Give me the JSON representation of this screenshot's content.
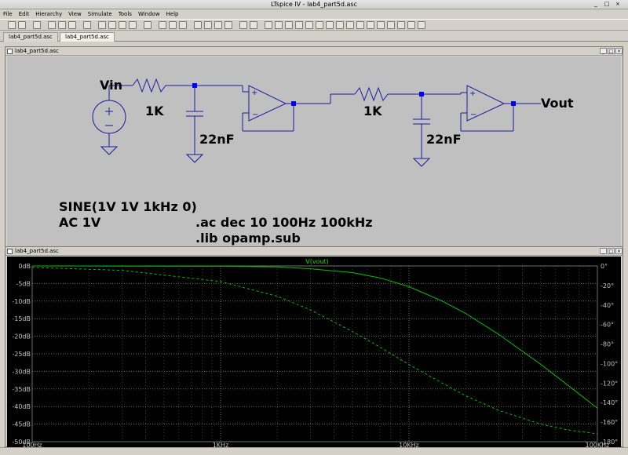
{
  "window": {
    "title": "LTspice IV - lab4_part5d.asc"
  },
  "menu": [
    "File",
    "Edit",
    "Hierarchy",
    "View",
    "Simulate",
    "Tools",
    "Window",
    "Help"
  ],
  "tabs": [
    {
      "label": "lab4_part5d.asc",
      "active": false
    },
    {
      "label": "lab4_part5d.asc",
      "active": true
    }
  ],
  "toolbar": {
    "icons": [
      "new-schematic-icon",
      "open-icon",
      "save-icon",
      "control-panel-icon",
      "run-icon",
      "halt-icon",
      "pan-icon",
      "zoom-in-icon",
      "zoom-out-icon",
      "zoom-full-icon",
      "zoom-cancel-icon",
      "waveform-icon",
      "tile-horizontal-icon",
      "tile-vertical-icon",
      "cascade-icon",
      "cut-icon",
      "copy-icon",
      "paste-icon",
      "find-icon",
      "print-icon",
      "print-setup-icon",
      "draw-wire-icon",
      "ground-icon",
      "label-net-icon",
      "resistor-icon",
      "capacitor-icon",
      "inductor-icon",
      "diode-icon",
      "component-icon",
      "rotate-icon",
      "mirror-icon",
      "undo-icon",
      "redo-icon",
      "move-icon",
      "drag-icon",
      "text-icon",
      "spice-directive-icon"
    ]
  },
  "schematic": {
    "title": "lab4_part5d.asc",
    "labels": {
      "vin": "Vin",
      "vout": "Vout",
      "r1": "1K",
      "r2": "1K",
      "c1": "22nF",
      "c2": "22nF",
      "source_sine": "SINE(1V 1V 1kHz 0)",
      "source_ac": "AC 1V",
      "ac_directive": ".ac dec 10 100Hz 100kHz",
      "lib_directive": ".lib opamp.sub"
    }
  },
  "plot": {
    "title": "lab4_part5d.asc",
    "trace_label": "V(vout)",
    "colors": {
      "background": "#000000",
      "grid": "#707070",
      "trace": "#00c000",
      "trace_label": "#00e000",
      "axis_text": "#c0c0c0"
    },
    "chart_data": {
      "type": "line",
      "xscale": "log",
      "xlim": [
        100,
        100000
      ],
      "x_ticks": [
        "100Hz",
        "1KHz",
        "10KHz",
        "100KHz"
      ],
      "y_left_ticks": [
        "0dB",
        "-5dB",
        "-10dB",
        "-15dB",
        "-20dB",
        "-25dB",
        "-30dB",
        "-35dB",
        "-40dB",
        "-45dB",
        "-50dB"
      ],
      "y_right_ticks": [
        "0°",
        "-20°",
        "-40°",
        "-60°",
        "-80°",
        "-100°",
        "-120°",
        "-140°",
        "-160°",
        "-180°"
      ],
      "ylim_left": [
        -50,
        0
      ],
      "ylim_right": [
        -180,
        0
      ],
      "series": [
        {
          "name": "V(vout)",
          "axis": "left",
          "style": "solid",
          "x": [
            100,
            300,
            1000,
            2000,
            3000,
            5000,
            7000,
            10000,
            15000,
            20000,
            30000,
            50000,
            70000,
            100000
          ],
          "values": [
            0,
            -0.05,
            -0.1,
            -0.3,
            -0.8,
            -1.9,
            -3.4,
            -5.9,
            -10.0,
            -13.5,
            -19.5,
            -28.0,
            -34.0,
            -40.5
          ]
        },
        {
          "name": "phase",
          "axis": "right",
          "style": "dashed",
          "x": [
            100,
            300,
            1000,
            2000,
            3000,
            5000,
            7000,
            10000,
            15000,
            20000,
            30000,
            50000,
            70000,
            100000
          ],
          "values": [
            -1.5,
            -4.5,
            -16,
            -31,
            -45,
            -67,
            -83,
            -101,
            -120,
            -133,
            -148,
            -162,
            -168,
            -172
          ]
        }
      ]
    }
  }
}
